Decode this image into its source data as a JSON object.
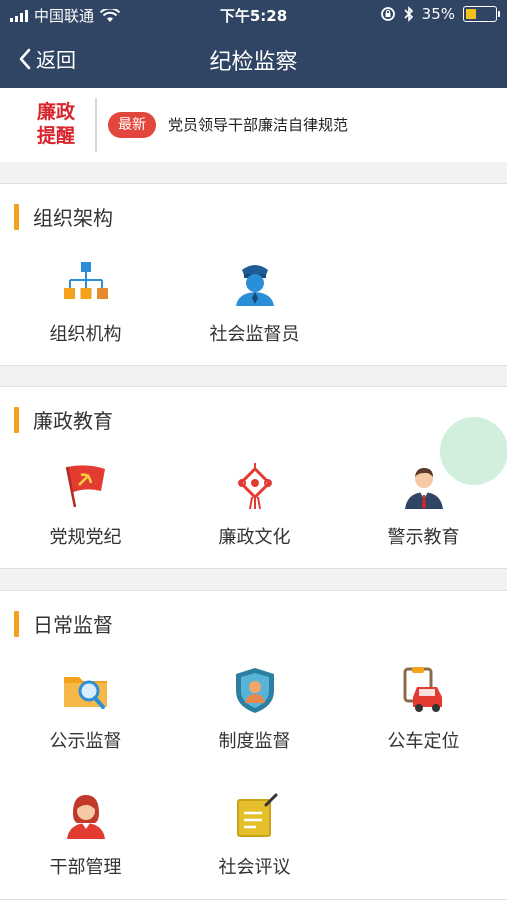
{
  "status_bar": {
    "carrier": "中国联通",
    "time": "下午5:28",
    "battery": "35%",
    "battery_level": 0.35
  },
  "nav": {
    "back_label": "返回",
    "title": "纪检监察"
  },
  "notice": {
    "logo_line1": "廉政",
    "logo_line2": "提醒",
    "badge": "最新",
    "text": "党员领导干部廉洁自律规范"
  },
  "sections": [
    {
      "title": "组织架构",
      "items": [
        {
          "label": "组织机构",
          "icon": "org-chart-icon"
        },
        {
          "label": "社会监督员",
          "icon": "police-officer-icon"
        }
      ]
    },
    {
      "title": "廉政教育",
      "items": [
        {
          "label": "党规党纪",
          "icon": "party-flag-icon"
        },
        {
          "label": "廉政文化",
          "icon": "chinese-knot-icon"
        },
        {
          "label": "警示教育",
          "icon": "person-suit-icon"
        }
      ]
    },
    {
      "title": "日常监督",
      "items": [
        {
          "label": "公示监督",
          "icon": "folder-search-icon"
        },
        {
          "label": "制度监督",
          "icon": "shield-person-icon"
        },
        {
          "label": "公车定位",
          "icon": "car-clipboard-icon"
        },
        {
          "label": "干部管理",
          "icon": "female-cadre-icon"
        },
        {
          "label": "社会评议",
          "icon": "notebook-pen-icon"
        }
      ]
    }
  ],
  "colors": {
    "nav_bg": "#2f4563",
    "accent_orange": "#f4a21b",
    "badge_red": "#e2473d",
    "logo_red": "#d8242c"
  }
}
